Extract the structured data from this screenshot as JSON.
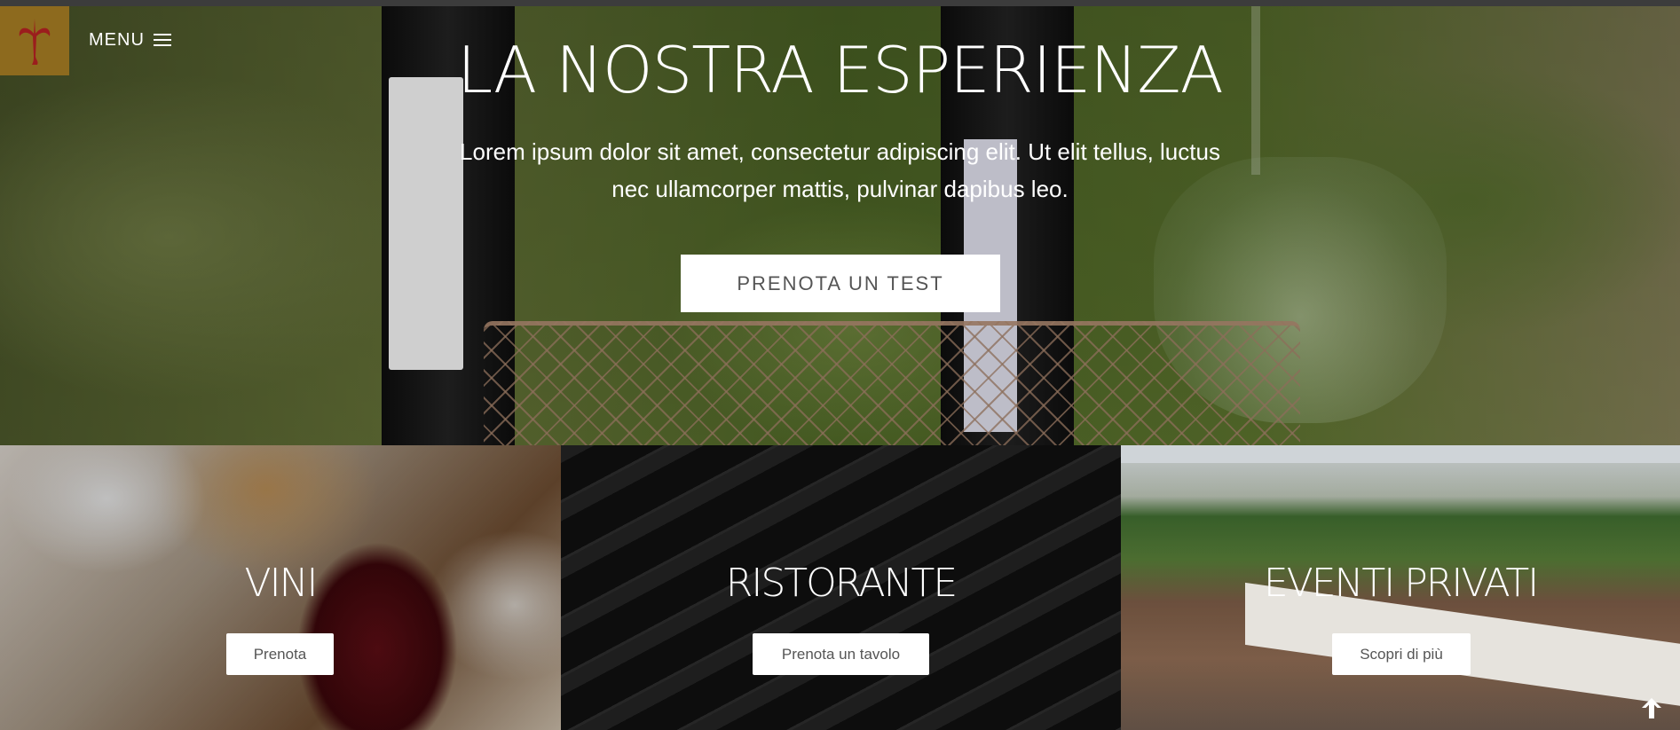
{
  "header": {
    "logo_icon": "grape-vine-logo-icon",
    "menu_label": "MENU",
    "menu_icon": "hamburger-icon",
    "brand_color": "#8d6a1e"
  },
  "hero": {
    "title": "LA NOSTRA ESPERIENZA",
    "text": "Lorem ipsum dolor sit amet, consectetur adipiscing elit. Ut elit tellus, luctus nec ullamcorper mattis, pulvinar dapibus leo.",
    "button_label": "PRENOTA UN TEST"
  },
  "tiles": [
    {
      "title": "VINI",
      "button_label": "Prenota"
    },
    {
      "title": "RISTORANTE",
      "button_label": "Prenota un tavolo"
    },
    {
      "title": "EVENTI PRIVATI",
      "button_label": "Scopri di più"
    }
  ],
  "scroll_top_icon": "arrow-up-icon"
}
